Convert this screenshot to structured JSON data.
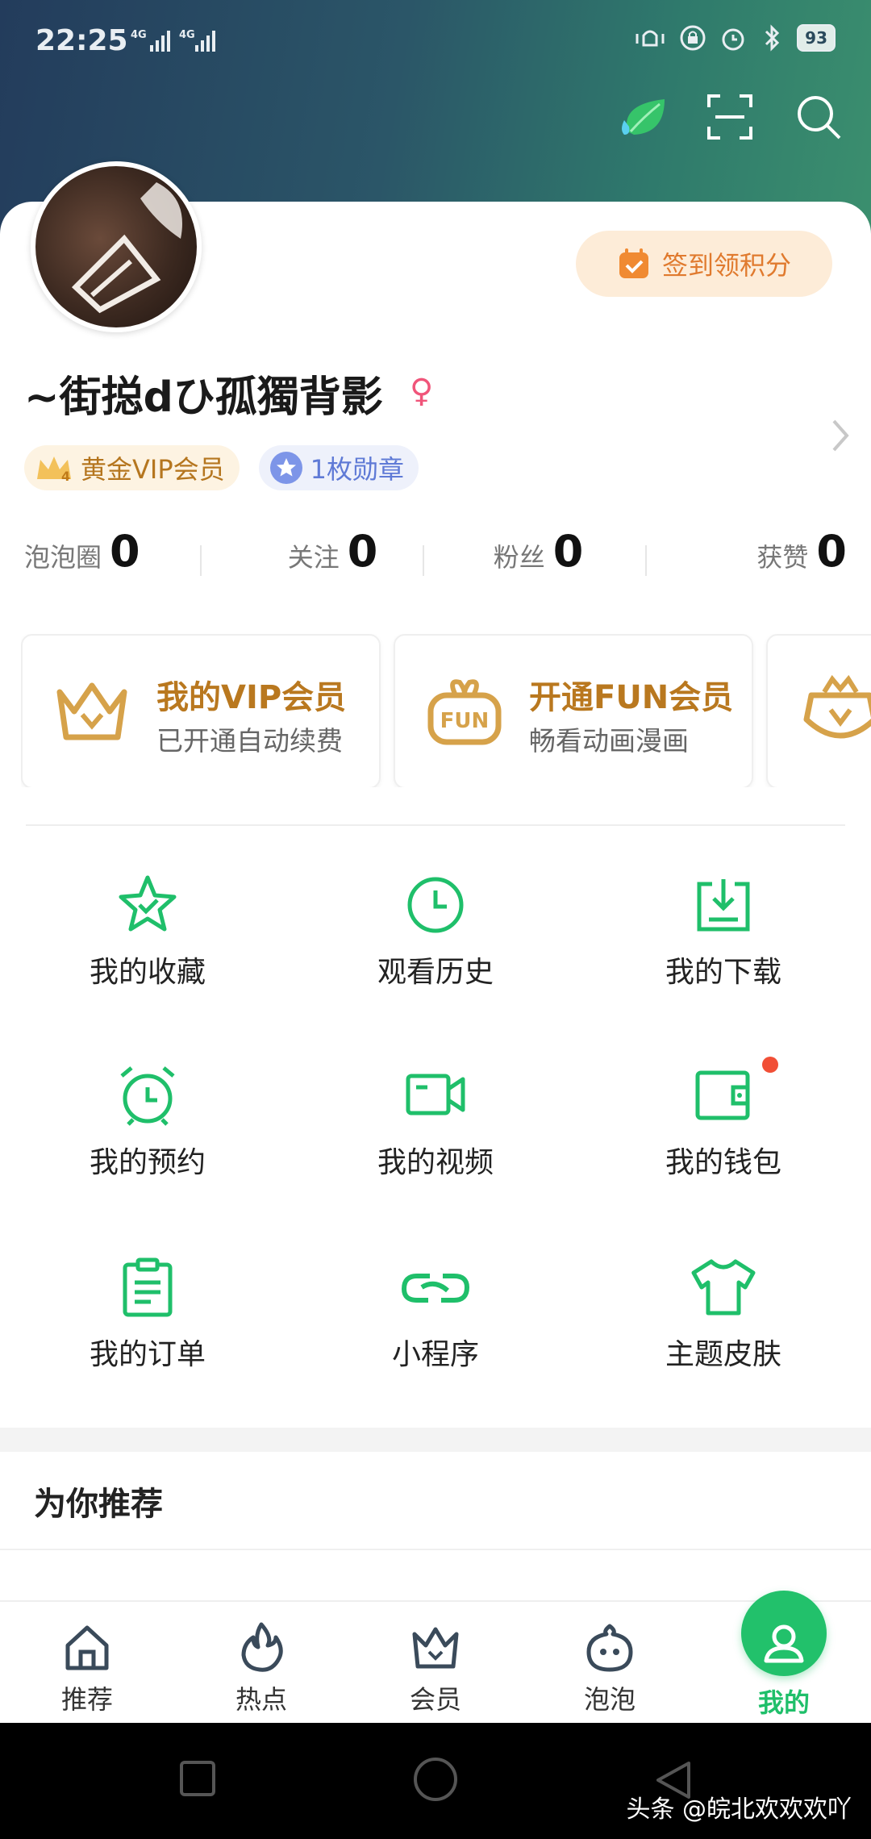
{
  "status_bar": {
    "time": "22:25",
    "signal_1": "4G",
    "signal_2": "4G",
    "battery": "93"
  },
  "header": {
    "icons": [
      "leaf-water-icon",
      "scan-icon",
      "search-icon"
    ]
  },
  "profile": {
    "checkin_label": "签到领积分",
    "username": "~街搃dひ孤獨背影",
    "gender_symbol": "♀",
    "vip_badge": "黄金VIP会员",
    "medal_badge": "1枚勋章"
  },
  "stats": [
    {
      "label": "泡泡圈",
      "value": "0"
    },
    {
      "label": "关注",
      "value": "0"
    },
    {
      "label": "粉丝",
      "value": "0"
    },
    {
      "label": "获赞",
      "value": "0"
    }
  ],
  "promos": [
    {
      "title": "我的VIP会员",
      "subtitle": "已开通自动续费",
      "icon": "vip-crown-icon"
    },
    {
      "title": "开通FUN会员",
      "subtitle": "畅看动画漫画",
      "icon": "fun-badge-icon"
    }
  ],
  "grid": [
    {
      "label": "我的收藏",
      "icon": "star-check-icon"
    },
    {
      "label": "观看历史",
      "icon": "clock-icon"
    },
    {
      "label": "我的下载",
      "icon": "download-icon"
    },
    {
      "label": "我的预约",
      "icon": "alarm-clock-icon"
    },
    {
      "label": "我的视频",
      "icon": "video-camera-icon"
    },
    {
      "label": "我的钱包",
      "icon": "wallet-icon"
    },
    {
      "label": "我的订单",
      "icon": "clipboard-icon"
    },
    {
      "label": "小程序",
      "icon": "link-icon"
    },
    {
      "label": "主题皮肤",
      "icon": "tshirt-icon"
    }
  ],
  "recommend_title": "为你推荐",
  "tabs": [
    {
      "label": "推荐",
      "icon": "home-icon"
    },
    {
      "label": "热点",
      "icon": "flame-icon"
    },
    {
      "label": "会员",
      "icon": "crown-icon"
    },
    {
      "label": "泡泡",
      "icon": "bubble-face-icon"
    },
    {
      "label": "我的",
      "icon": "user-icon",
      "active": true
    }
  ],
  "watermark": "头条 @皖北欢欢欢吖",
  "colors": {
    "accent": "#22c16b",
    "gold": "#b9781f",
    "checkin": "#e07a2e"
  }
}
